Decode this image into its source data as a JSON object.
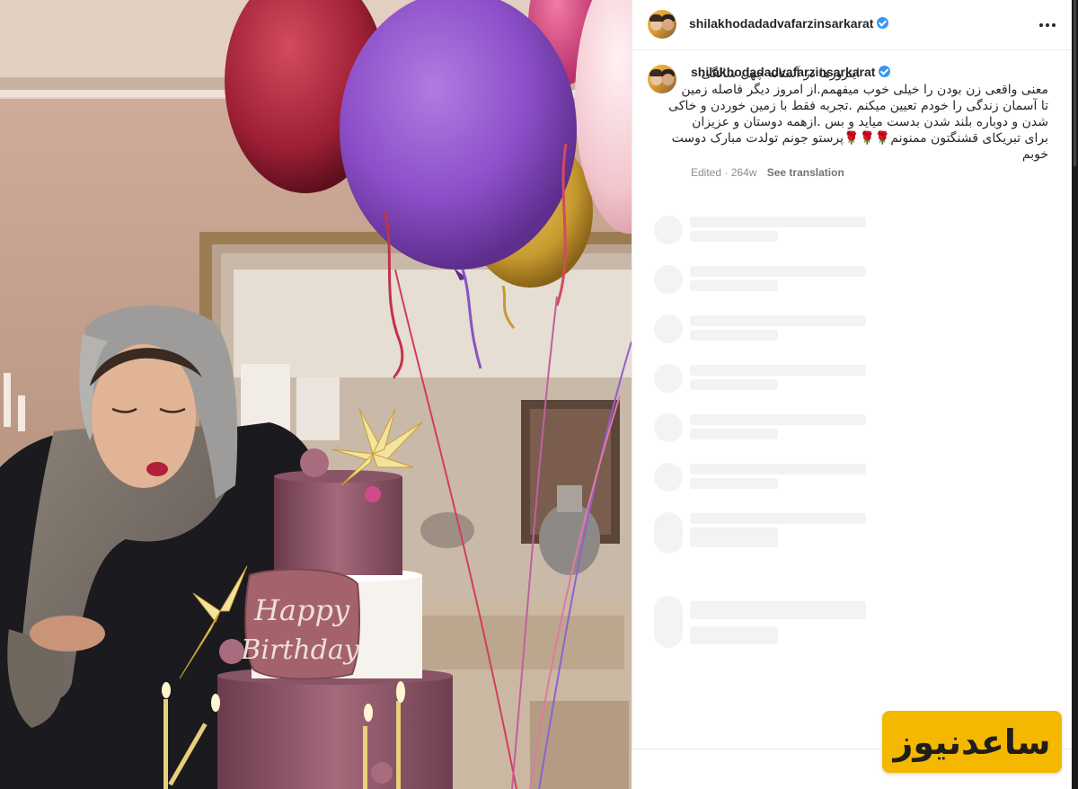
{
  "post": {
    "username": "shilakhodadadvafarzinsarkarat",
    "caption_lines": [
      "اینروزها در آستانه چهل سالگی",
      "معنی واقعی زن بودن را خیلی خوب میفهمم.از امروز دیگر فاصله زمین",
      "تا آسمان زندگی را خودم تعیین میکنم .تجربه فقط با زمین خوردن و خاکی",
      "شدن و دوباره بلند شدن بدست میاید و بس .ازهمه دوستان و عزیزان",
      "برای تبریکای قشنگتون ممنونم🌹🌹🌹پرستو جونم تولدت مبارک دوست",
      "خوبم"
    ],
    "edited_label": "Edited",
    "separator": "·",
    "age": "264w",
    "see_translation": "See translation"
  },
  "photo": {
    "cake_text_line1": "Happy",
    "cake_text_line2": "Birthday"
  },
  "watermark": {
    "text": "ساعدنیوز"
  },
  "colors": {
    "verified": "#3897f0",
    "badge_bg": "#f5b800",
    "skeleton": "#f3f3f3"
  }
}
